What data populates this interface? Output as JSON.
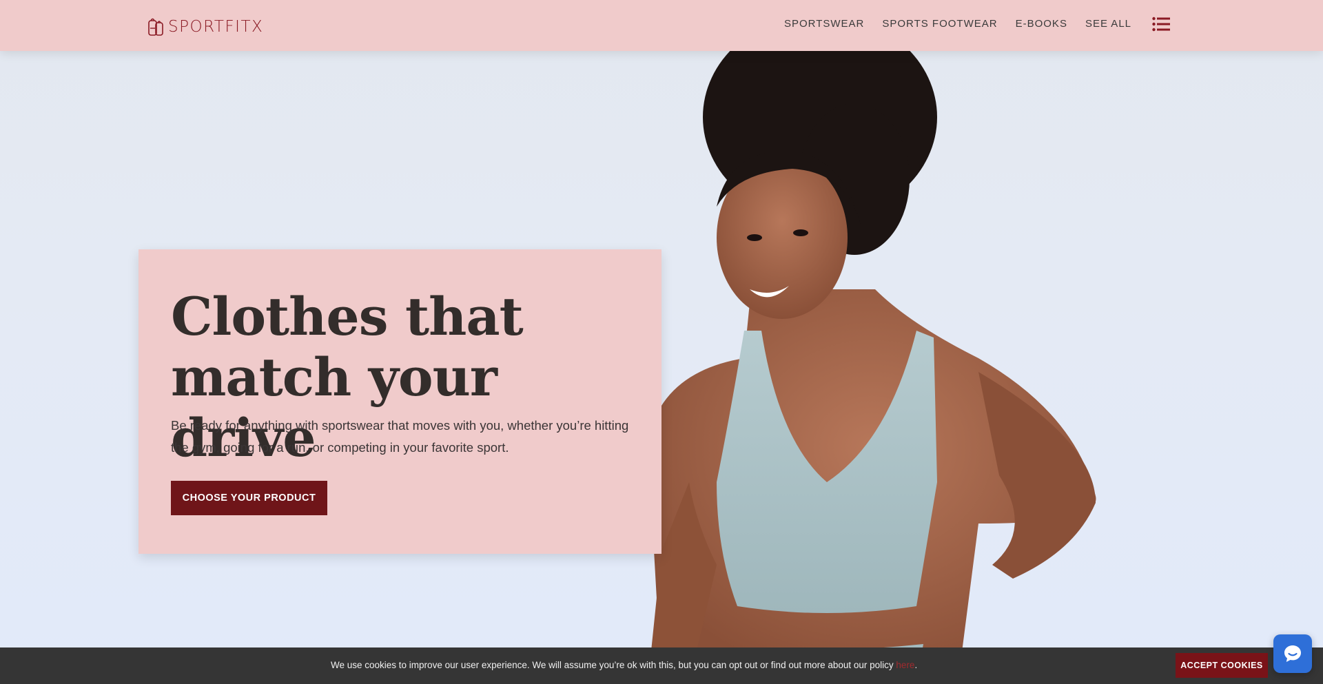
{
  "brand": {
    "name": "SPORTFITX",
    "color": "#8a1a24"
  },
  "nav": {
    "items": [
      {
        "label": "SPORTSWEAR"
      },
      {
        "label": "SPORTS FOOTWEAR"
      },
      {
        "label": "E-BOOKS"
      },
      {
        "label": "SEE ALL"
      }
    ],
    "menu_icon": "hamburger-list-icon"
  },
  "hero": {
    "title": "Clothes that match your drive",
    "subtitle": "Be ready for anything with sportswear that moves with you, whether you’re hitting the gym, going for a run, or competing in your favorite sport.",
    "cta_label": "CHOOSE YOUR PRODUCT"
  },
  "cookie": {
    "text": "We use cookies to improve our user experience. We will assume you’re ok with this, but you can opt out or find out more about our policy ",
    "link_label": "here",
    "end": ".",
    "accept_label": "ACCEPT COOKIES"
  },
  "chat": {
    "icon": "chat-bubble-icon"
  },
  "colors": {
    "header_bg": "#f0cbcb",
    "accent": "#6f1519",
    "cookie_bg": "#353535",
    "chat_bg": "#2e6fd8"
  }
}
